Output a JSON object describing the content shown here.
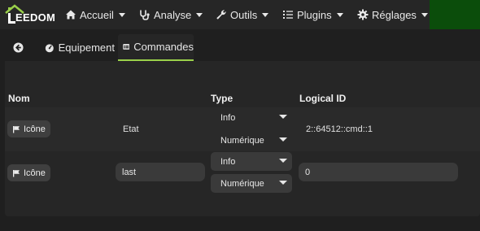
{
  "navbar": {
    "logo_text": "EEDOM",
    "items": [
      {
        "label": "Accueil",
        "icon": "home-icon"
      },
      {
        "label": "Analyse",
        "icon": "stethoscope-icon"
      },
      {
        "label": "Outils",
        "icon": "wrench-icon"
      },
      {
        "label": "Plugins",
        "icon": "list-icon"
      },
      {
        "label": "Réglages",
        "icon": "gear-icon"
      }
    ]
  },
  "tabs": {
    "back_icon": "arrow-left-circle-icon",
    "equipement": "Equipement",
    "commandes": "Commandes"
  },
  "table": {
    "headers": {
      "nom": "Nom",
      "type": "Type",
      "logical_id": "Logical ID"
    },
    "rows": [
      {
        "icon_button": "Icône",
        "name": "Etat",
        "type": "Info",
        "subtype": "Numérique",
        "logical_id": "2::64512::cmd::1"
      },
      {
        "icon_button": "Icône",
        "name": "last",
        "type": "Info",
        "subtype": "Numérique",
        "logical_id": "0"
      }
    ]
  },
  "colors": {
    "navbar_bg": "#262626",
    "accent_green": "#9ad04a",
    "corner_green": "#0b4d0b"
  }
}
